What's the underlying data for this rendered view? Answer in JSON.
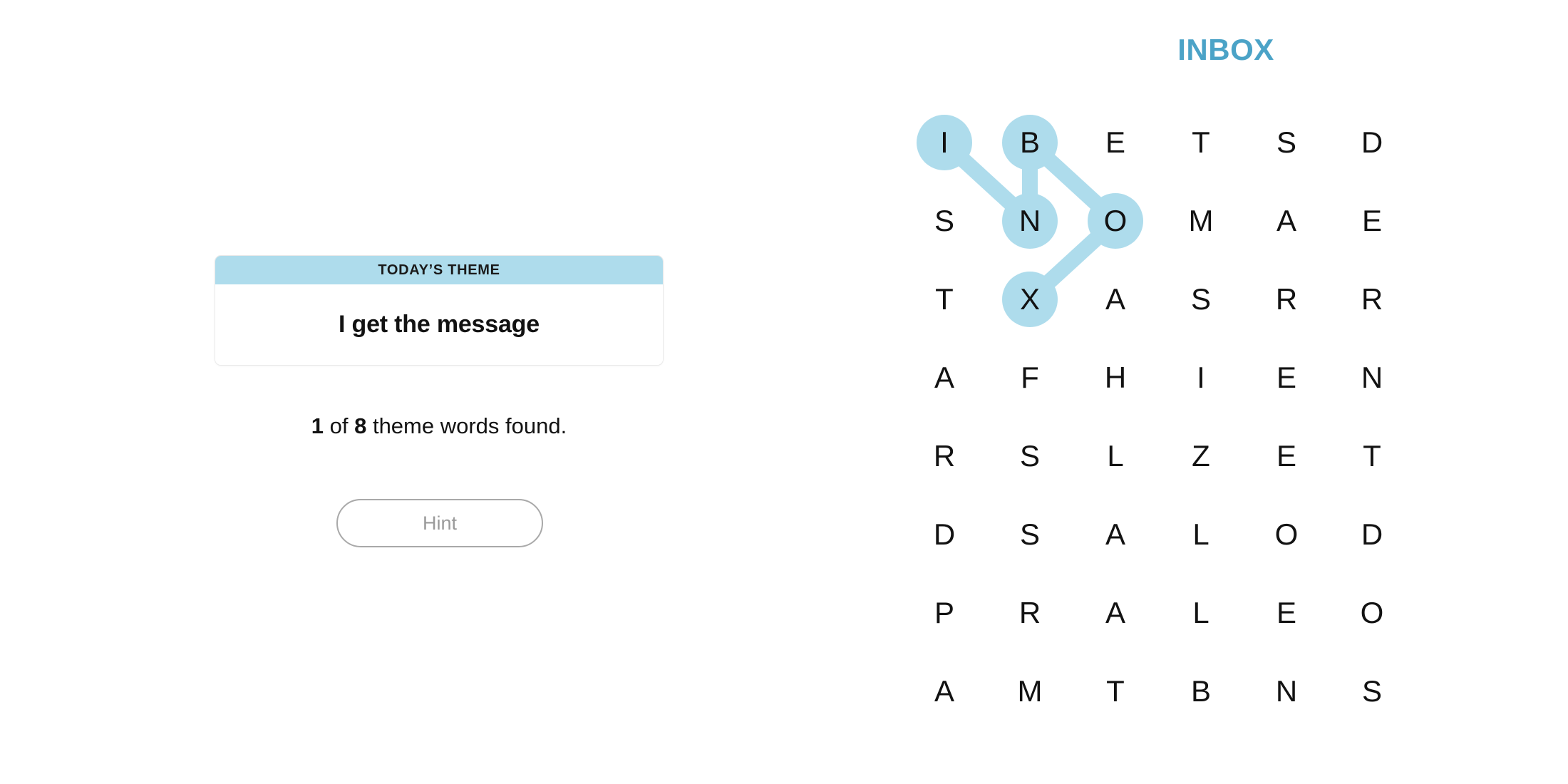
{
  "puzzle": {
    "title": "INBOX",
    "title_color": "#4ba3c7"
  },
  "theme_card": {
    "header_label": "TODAY’S THEME",
    "clue": "I get the message",
    "header_bg": "#aedcec"
  },
  "progress": {
    "found": "1",
    "middle_text": " of ",
    "total": "8",
    "suffix_text": " theme words found.",
    "full_text": "1 of 8 theme words found."
  },
  "hint_button": {
    "label": "Hint",
    "enabled": false
  },
  "grid": {
    "rows": 8,
    "cols": 6,
    "letters": [
      [
        "I",
        "B",
        "E",
        "T",
        "S",
        "D"
      ],
      [
        "S",
        "N",
        "O",
        "M",
        "A",
        "E"
      ],
      [
        "T",
        "X",
        "A",
        "S",
        "R",
        "R"
      ],
      [
        "A",
        "F",
        "H",
        "I",
        "E",
        "N"
      ],
      [
        "R",
        "S",
        "L",
        "Z",
        "E",
        "T"
      ],
      [
        "D",
        "S",
        "A",
        "L",
        "O",
        "D"
      ],
      [
        "P",
        "R",
        "A",
        "L",
        "E",
        "O"
      ],
      [
        "A",
        "M",
        "T",
        "B",
        "N",
        "S"
      ]
    ],
    "highlight_color": "#aedcec",
    "selected_path": {
      "word": "INBOX",
      "cells": [
        {
          "row": 0,
          "col": 0,
          "letter": "I"
        },
        {
          "row": 1,
          "col": 1,
          "letter": "N"
        },
        {
          "row": 0,
          "col": 1,
          "letter": "B"
        },
        {
          "row": 1,
          "col": 2,
          "letter": "O"
        },
        {
          "row": 2,
          "col": 1,
          "letter": "X"
        }
      ]
    }
  }
}
